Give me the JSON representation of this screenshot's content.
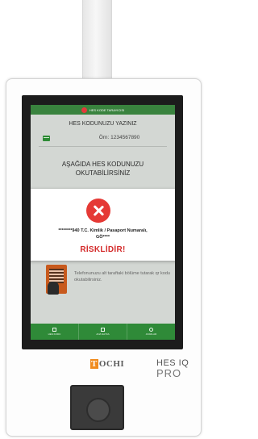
{
  "header": {
    "title": "HES KODE TARAYICISI"
  },
  "hes_input": {
    "label": "HES KODUNUZU YAZINIZ",
    "example": "Örn: 1234567890"
  },
  "scan_instruction": {
    "line1": "AŞAĞIDA HES KODUNUZU",
    "line2": "OKUTABİLİRSİNİZ"
  },
  "result_modal": {
    "id_line1": "********940 T.C. Kimlik / Pasaport Numaralı,",
    "id_line2": "GÖ****",
    "status": "RİSKLİDİR!",
    "status_color": "#d42a2a"
  },
  "phone_hint": "Telefonunuzu alt taraftaki bölüme tutarak qr kodu okutabilirsiniz.",
  "bottom_nav": [
    {
      "label": "HES KODU",
      "icon": "qr-icon"
    },
    {
      "label": "ANA SAYFA",
      "icon": "home-icon"
    },
    {
      "label": "AYARLAR",
      "icon": "gear-icon"
    }
  ],
  "device": {
    "brand_initial": "T",
    "brand_rest": "OCHI",
    "model_line1": "HES IQ",
    "model_line2": "PRO"
  },
  "colors": {
    "accent_green": "#2f8a38",
    "error_red": "#e53935",
    "brand_orange": "#f08a1c"
  }
}
